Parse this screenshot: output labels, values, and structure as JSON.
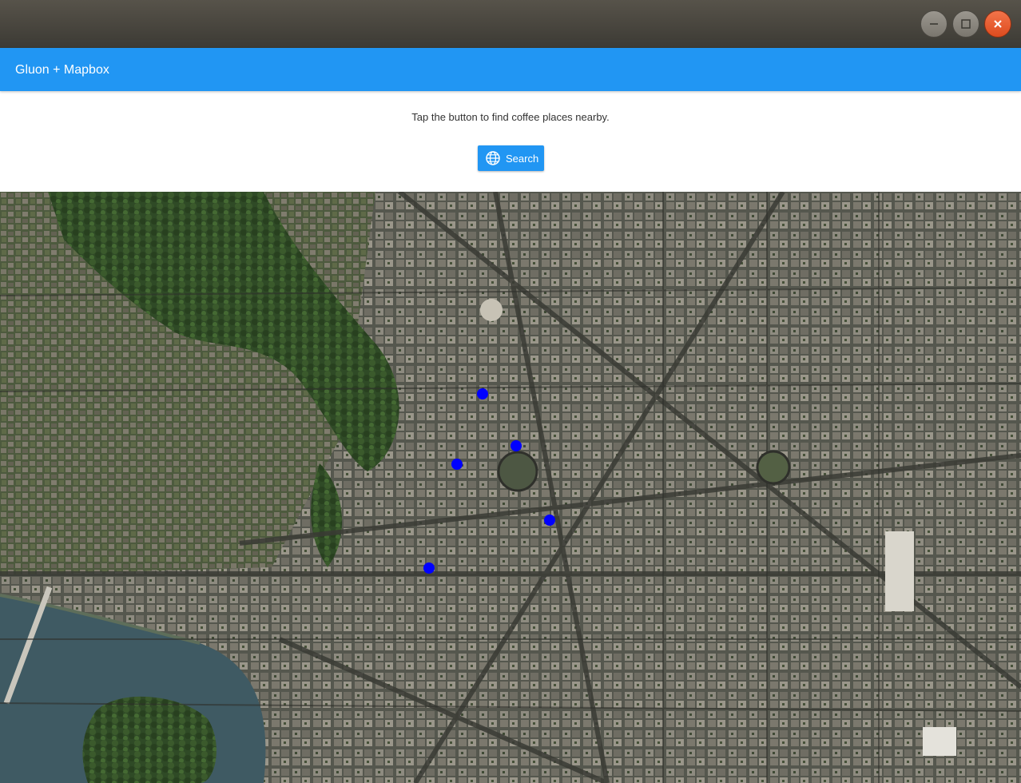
{
  "window": {
    "controls": {
      "minimize": "minimize-icon",
      "maximize": "maximize-icon",
      "close": "close-icon"
    }
  },
  "appbar": {
    "title": "Gluon + Mapbox",
    "color": "#2196f3"
  },
  "content": {
    "hint": "Tap the button to find coffee places nearby.",
    "search_button": {
      "label": "Search",
      "icon": "globe-icon"
    }
  },
  "map": {
    "style": "satellite",
    "marker_color": "#0000ff",
    "markers": [
      {
        "name": "coffee-marker-1"
      },
      {
        "name": "coffee-marker-2"
      },
      {
        "name": "coffee-marker-3"
      },
      {
        "name": "coffee-marker-4"
      },
      {
        "name": "coffee-marker-5"
      }
    ]
  }
}
